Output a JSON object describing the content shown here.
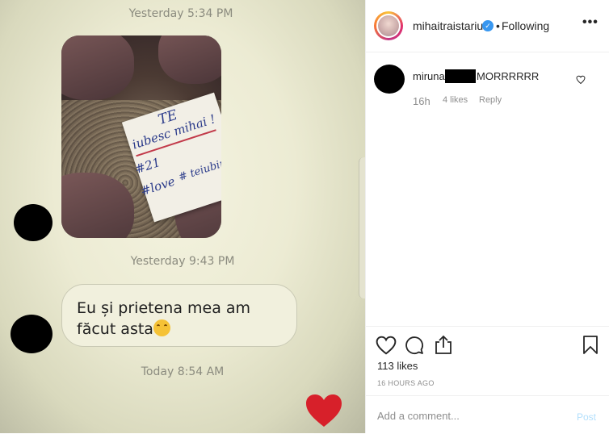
{
  "chat_photo": {
    "timestamps": [
      "Yesterday 5:34 PM",
      "Yesterday 9:43 PM",
      "Today 8:54 AM"
    ],
    "paper_note": [
      "TE",
      "iubesc mihai !",
      "#21",
      "#love",
      "# teiubim"
    ],
    "message_text": "Eu și prietena mea am făcut asta",
    "heart_color": "#d7202a"
  },
  "post": {
    "username": "mihaitraistariu",
    "separator": "•",
    "follow_status": "Following",
    "more_label": "•••",
    "comments": [
      {
        "user_prefix": "miruna",
        "text": "MORRRRRR",
        "time": "16h",
        "likes": "4 likes",
        "reply": "Reply"
      }
    ],
    "likes": "113 likes",
    "time_ago": "16 HOURS AGO",
    "comment_placeholder": "Add a comment...",
    "post_button": "Post"
  }
}
